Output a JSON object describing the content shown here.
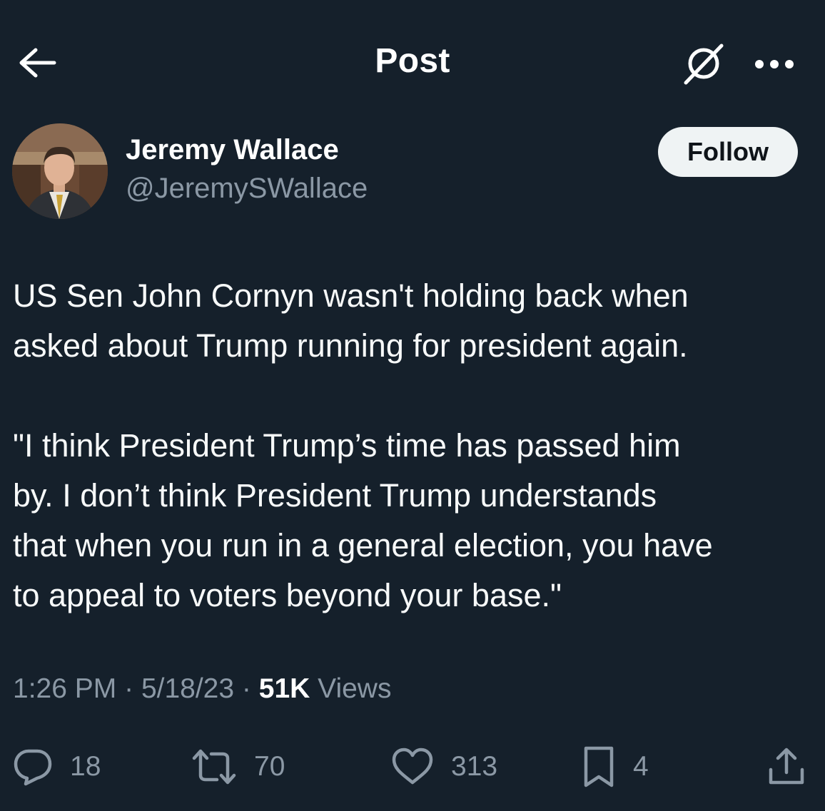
{
  "header": {
    "title": "Post",
    "back_icon": "arrow-left-icon",
    "grok_icon": "grok-icon",
    "more_icon": "more-horizontal-icon"
  },
  "author": {
    "name": "Jeremy Wallace",
    "handle": "@JeremySWallace",
    "follow_label": "Follow"
  },
  "tweet": {
    "lines": [
      "US Sen John Cornyn wasn't holding  back when",
      "asked about Trump running for president again.",
      "",
      "\"I think President Trump’s time has passed him",
      "by. I don’t think President Trump understands",
      "that when you run in a general election, you have",
      "to appeal to voters beyond your base.\""
    ]
  },
  "meta": {
    "time": "1:26 PM",
    "date": "5/18/23",
    "separator": "·",
    "views_count": "51K",
    "views_label": "Views"
  },
  "actions": {
    "replies": "18",
    "reposts": "70",
    "likes": "313",
    "bookmarks": "4"
  },
  "colors": {
    "background": "#15202b",
    "text": "#ffffff",
    "secondary": "#8b98a5",
    "follow_bg": "#eff3f4"
  }
}
